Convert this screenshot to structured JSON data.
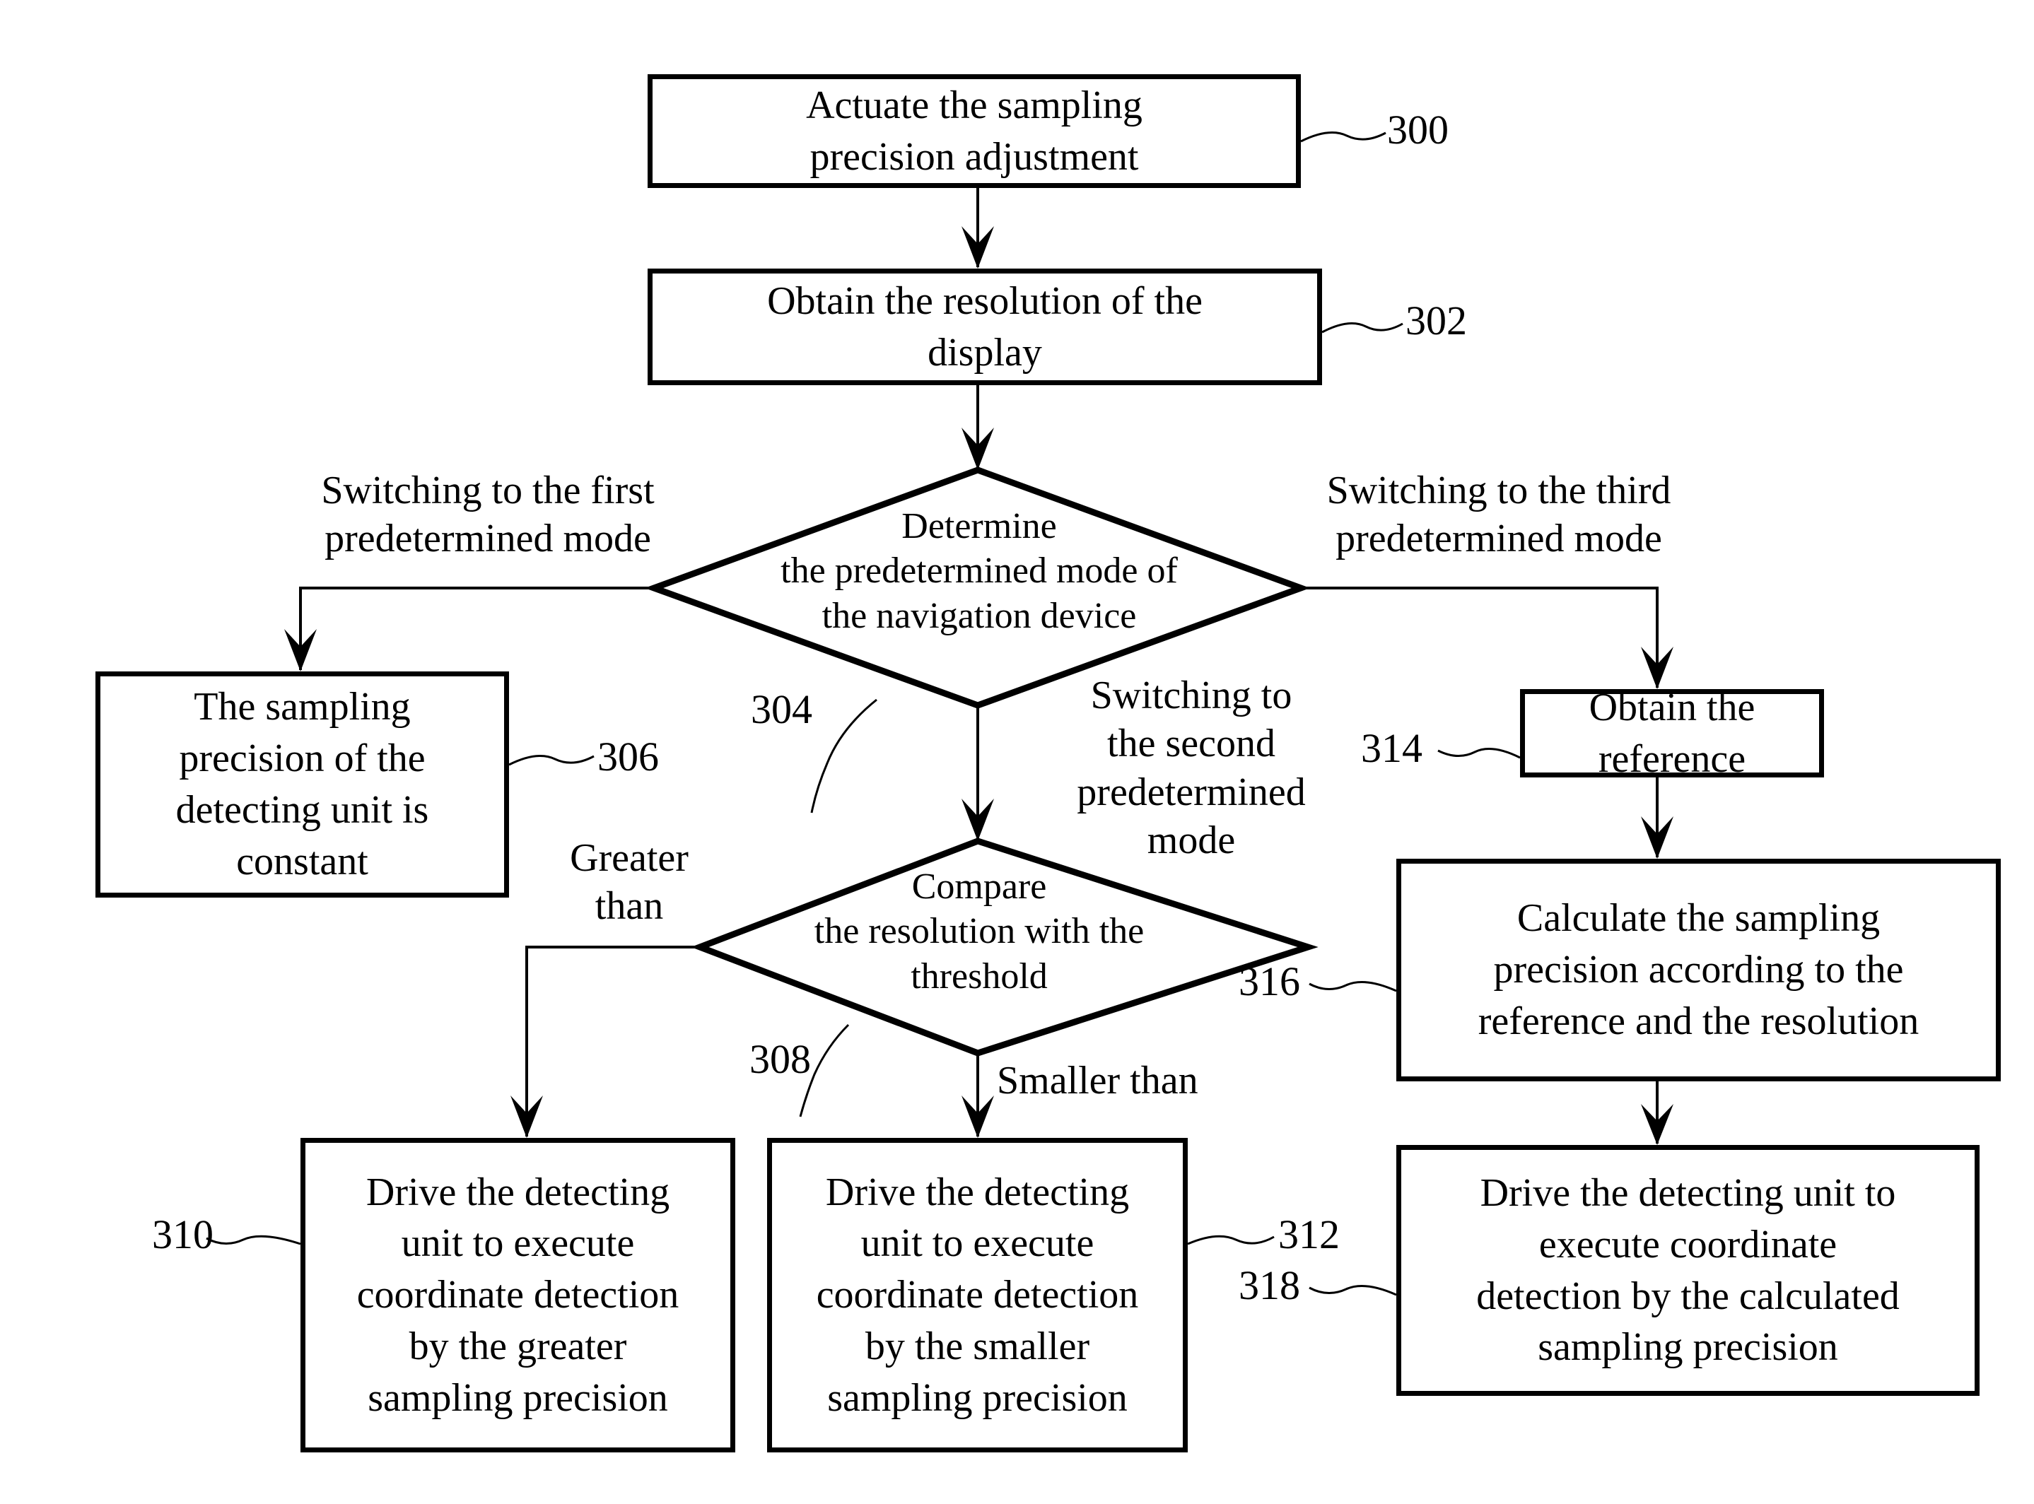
{
  "figure": {
    "type": "patent-flowchart",
    "background_color": "#ffffff",
    "line_color": "#000000"
  },
  "nodes": [
    {
      "id": "n300",
      "shape": "rect",
      "text": "Actuate the sampling\nprecision adjustment",
      "ref": "300"
    },
    {
      "id": "n302",
      "shape": "rect",
      "text": "Obtain the resolution of the\ndisplay",
      "ref": "302"
    },
    {
      "id": "n304",
      "shape": "diamond",
      "text": "Determine\nthe predetermined mode of\nthe navigation device",
      "ref": "304"
    },
    {
      "id": "n306",
      "shape": "rect",
      "text": "The sampling\nprecision of the\ndetecting unit is\nconstant",
      "ref": "306"
    },
    {
      "id": "n308",
      "shape": "diamond",
      "text": "Compare\nthe resolution with the\nthreshold",
      "ref": "308"
    },
    {
      "id": "n310",
      "shape": "rect",
      "text": "Drive the detecting\nunit to execute\ncoordinate detection\nby the greater\nsampling precision",
      "ref": "310"
    },
    {
      "id": "n312",
      "shape": "rect",
      "text": "Drive the detecting\nunit to execute\ncoordinate detection\nby the smaller\nsampling precision",
      "ref": "312"
    },
    {
      "id": "n314",
      "shape": "rect",
      "text": "Obtain the\nreference",
      "ref": "314"
    },
    {
      "id": "n316",
      "shape": "rect",
      "text": "Calculate the sampling\nprecision according to the\nreference and the resolution",
      "ref": "316"
    },
    {
      "id": "n318",
      "shape": "rect",
      "text": "Drive the detecting unit to\nexecute coordinate\ndetection by the calculated\nsampling precision",
      "ref": "318"
    }
  ],
  "edge_labels": [
    {
      "id": "e_first",
      "text": "Switching to the first\npredetermined mode"
    },
    {
      "id": "e_third",
      "text": "Switching to the third\npredetermined mode"
    },
    {
      "id": "e_second",
      "text": "Switching to\nthe second\npredetermined\nmode"
    },
    {
      "id": "e_greater",
      "text": "Greater\nthan"
    },
    {
      "id": "e_smaller",
      "text": "Smaller than"
    }
  ],
  "ref_numbers": {
    "r300": "300",
    "r302": "302",
    "r304": "304",
    "r306": "306",
    "r308": "308",
    "r310": "310",
    "r312": "312",
    "r314": "314",
    "r316": "316",
    "r318": "318"
  }
}
